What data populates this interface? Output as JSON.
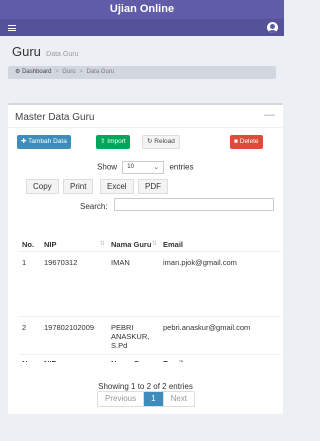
{
  "app": {
    "title": "Ujian Online"
  },
  "header": {
    "title": "Guru",
    "subtitle": "Data Guru"
  },
  "breadcrumb": {
    "items": [
      "Dashboard",
      "Guru",
      "Data Guru"
    ]
  },
  "box": {
    "title": "Master Data Guru",
    "collapse_icon": "minus-icon"
  },
  "actions": {
    "add": "Tambah Data",
    "import": "Import",
    "reload": "Reload",
    "delete": "Delete"
  },
  "length": {
    "show": "Show",
    "value": "10",
    "entries": "entries"
  },
  "export": {
    "copy": "Copy",
    "print": "Print",
    "excel": "Excel",
    "pdf": "PDF"
  },
  "search": {
    "label": "Search:",
    "value": ""
  },
  "table": {
    "columns": [
      "No.",
      "NIP",
      "Nama Guru",
      "Email"
    ],
    "rows": [
      {
        "no": "1",
        "nip": "19670312",
        "nama": "IMAN",
        "email": "iman.pjok@gmail.com"
      },
      {
        "no": "2",
        "nip": "197802102009",
        "nama": "PEBRI ANASKUR, S.Pd",
        "email": "pebri.anaskur@gmail.com"
      }
    ]
  },
  "info": "Showing 1 to 2 of 2 entries",
  "pagination": {
    "previous": "Previous",
    "current": "1",
    "next": "Next"
  },
  "colors": {
    "brand": "#605ca8",
    "primary": "#3c8dbc",
    "success": "#00a65a",
    "danger": "#dd4b39"
  }
}
